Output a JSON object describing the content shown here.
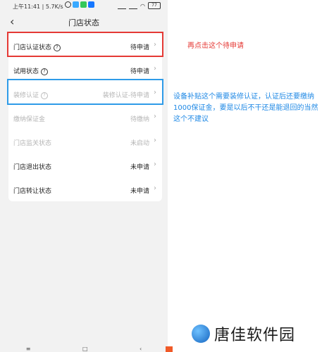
{
  "status_bar": {
    "time": "上午11:41",
    "speed": "5.7K/s",
    "battery": "77"
  },
  "nav": {
    "back_icon": "chevron-left-icon",
    "title": "门店状态"
  },
  "rows": [
    {
      "label": "门店认证状态",
      "help": true,
      "value": "待申请",
      "disabled": false
    },
    {
      "label": "试用状态",
      "help": true,
      "value": "待申请",
      "disabled": false
    },
    {
      "label": "装修认证",
      "help": true,
      "value": "装修认证-待申请",
      "disabled": true
    },
    {
      "label": "缴纳保证金",
      "help": false,
      "value": "待缴纳",
      "disabled": true
    },
    {
      "label": "门店监关状态",
      "help": false,
      "value": "未启动",
      "disabled": true
    },
    {
      "label": "门店退出状态",
      "help": false,
      "value": "未申请",
      "disabled": false
    },
    {
      "label": "门店转让状态",
      "help": false,
      "value": "未申请",
      "disabled": false
    }
  ],
  "annotations": {
    "red": "再点击这个待申请",
    "blue": "设备补贴这个需要装修认证，认证后还要缴纳1000保证金，要是以后不干还是能退回的当然这个不建议"
  },
  "watermark": {
    "text": "唐佳软件园"
  },
  "colors": {
    "red": "#e53935",
    "blue": "#2e9be8",
    "background": "#f2f2f2"
  }
}
